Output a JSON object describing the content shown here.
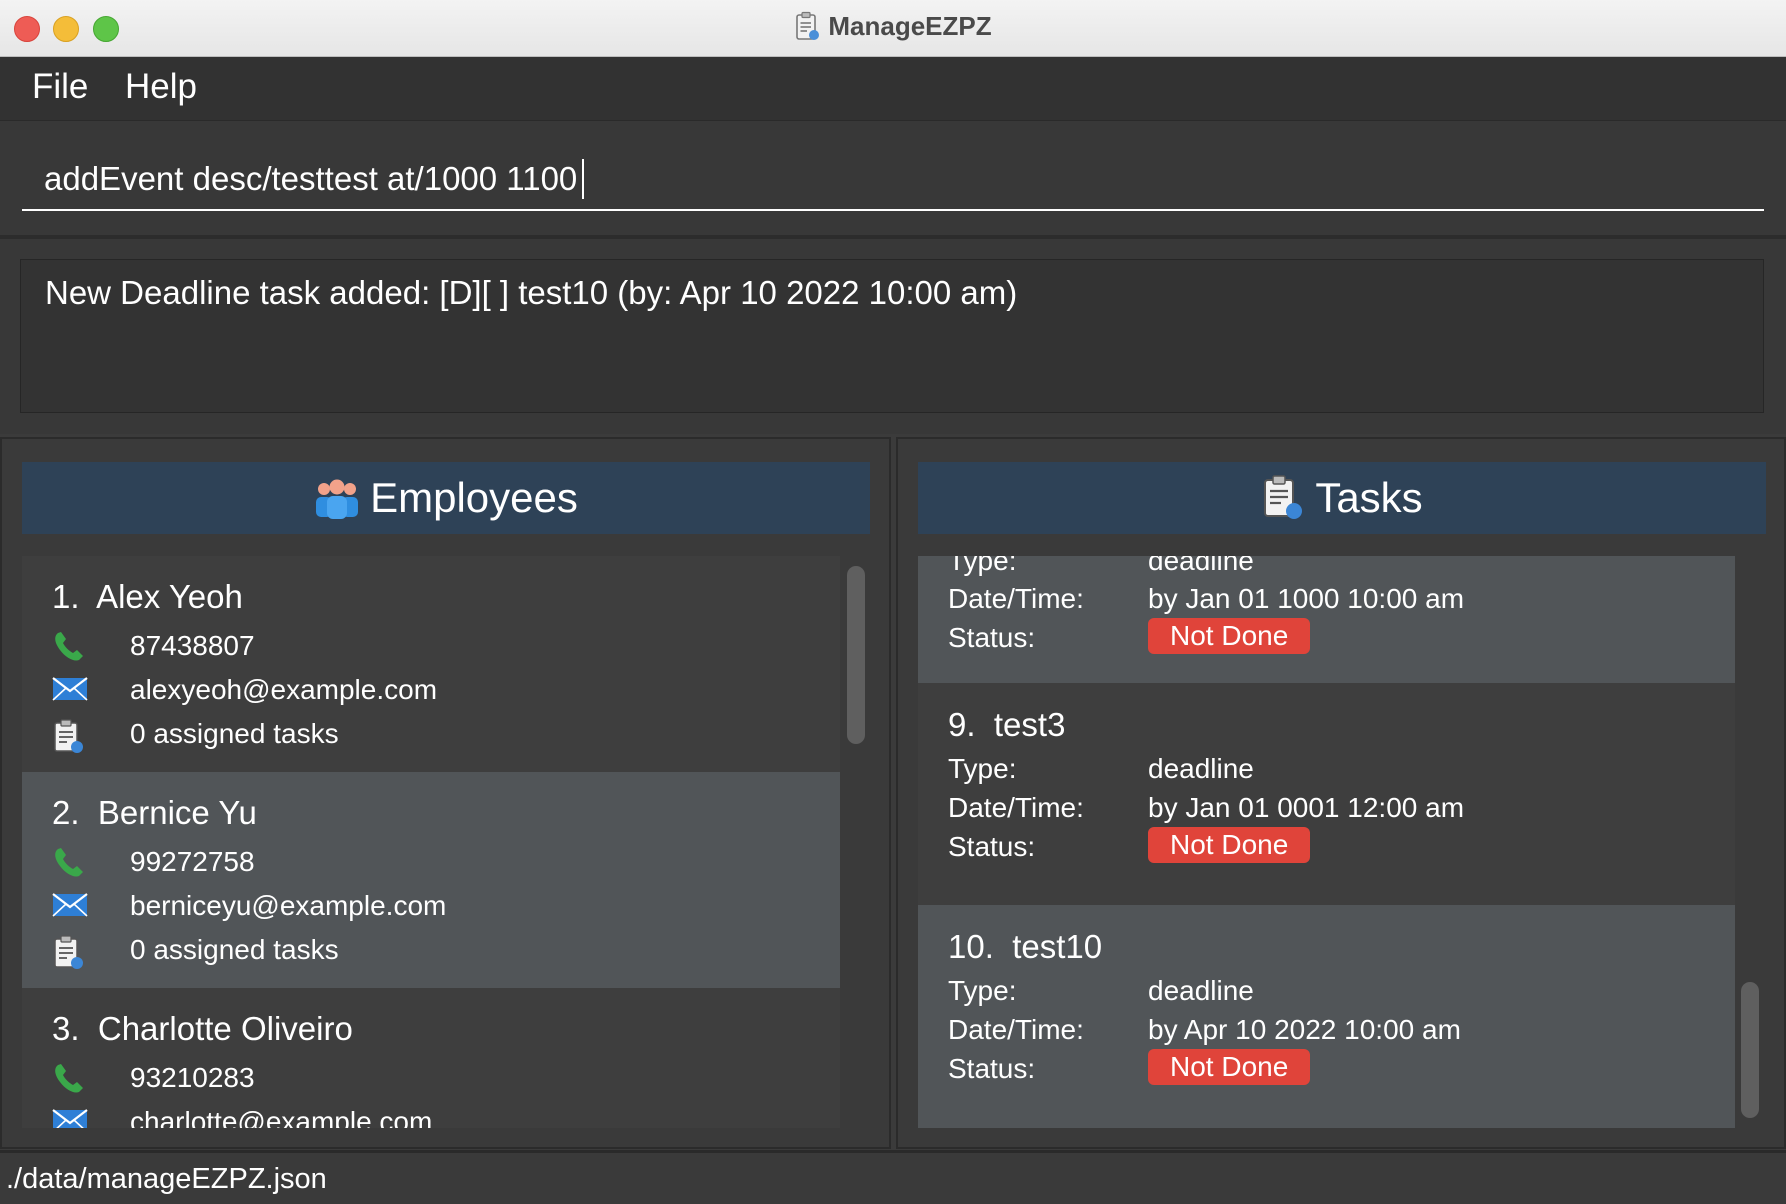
{
  "window": {
    "title": "ManageEZPZ"
  },
  "menu": {
    "items": [
      {
        "label": "File"
      },
      {
        "label": "Help"
      }
    ]
  },
  "command": {
    "value": "addEvent desc/testtest at/1000 1100"
  },
  "result": {
    "text": "New Deadline task added: [D][ ] test10 (by: Apr 10 2022 10:00 am)"
  },
  "employees": {
    "header": "Employees",
    "items": [
      {
        "index": "1.",
        "name": "Alex Yeoh",
        "phone": "87438807",
        "email": "alexyeoh@example.com",
        "tasks": "0 assigned tasks"
      },
      {
        "index": "2.",
        "name": "Bernice Yu",
        "phone": "99272758",
        "email": "berniceyu@example.com",
        "tasks": "0 assigned tasks"
      },
      {
        "index": "3.",
        "name": "Charlotte Oliveiro",
        "phone": "93210283",
        "email": "charlotte@example.com",
        "tasks": ""
      }
    ]
  },
  "tasks": {
    "header": "Tasks",
    "labels": {
      "type": "Type:",
      "datetime": "Date/Time:",
      "status": "Status:"
    },
    "items": [
      {
        "index": "",
        "name": "",
        "type": "deadline",
        "datetime": "by Jan 01 1000 10:00 am",
        "status": "Not Done"
      },
      {
        "index": "9.",
        "name": "test3",
        "type": "deadline",
        "datetime": "by Jan 01 0001 12:00 am",
        "status": "Not Done"
      },
      {
        "index": "10.",
        "name": "test10",
        "type": "deadline",
        "datetime": "by Apr 10 2022 10:00 am",
        "status": "Not Done"
      }
    ]
  },
  "status_bar": {
    "path": "./data/manageEZPZ.json"
  },
  "colors": {
    "header_bg": "#2e4257",
    "badge_red": "#e0443a",
    "phone_green": "#3aa84a",
    "email_blue": "#2e7fd6"
  }
}
